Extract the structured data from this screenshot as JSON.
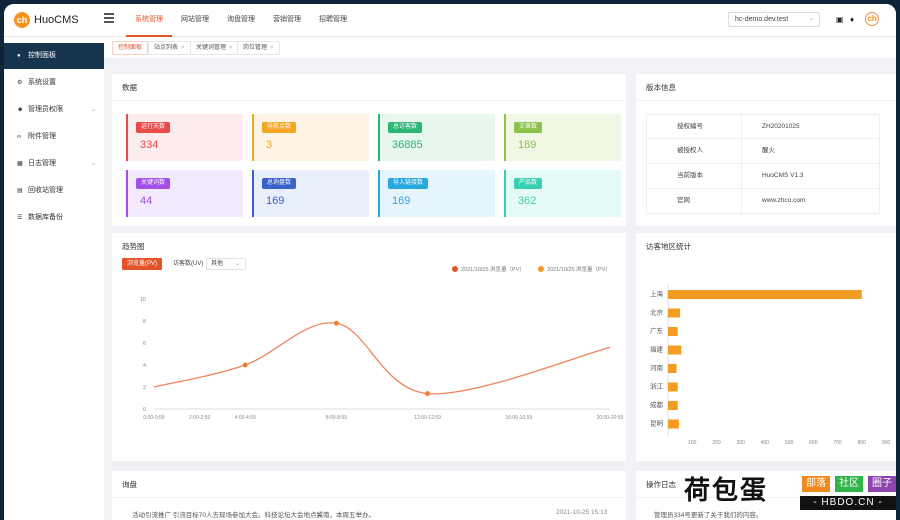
{
  "header": {
    "brand": "HuoCMS",
    "logo_text": "ch",
    "nav": [
      "系统管理",
      "网站管理",
      "询盘管理",
      "营销管理",
      "招聘管理"
    ],
    "site": "hc-demo.dev.test"
  },
  "sidebar": {
    "items": [
      {
        "label": "控制面板",
        "icon": "dashboard-icon"
      },
      {
        "label": "系统设置",
        "icon": "gear-icon"
      },
      {
        "label": "管理员权限",
        "icon": "user-icon"
      },
      {
        "label": "附件管理",
        "icon": "paperclip-icon"
      },
      {
        "label": "日志管理",
        "icon": "log-icon"
      },
      {
        "label": "回收站管理",
        "icon": "trash-icon"
      },
      {
        "label": "数据库备份",
        "icon": "database-icon"
      }
    ]
  },
  "tabs": [
    "控制面板",
    "站点列表",
    "关键词管理",
    "岗位管理"
  ],
  "data_card": {
    "title": "数据",
    "stats": [
      {
        "label": "运行天数",
        "value": "334",
        "color": "#e94b4b"
      },
      {
        "label": "导航点数",
        "value": "3",
        "color": "#f5a623"
      },
      {
        "label": "总访客数",
        "value": "36885",
        "color": "#2bb673"
      },
      {
        "label": "文章数",
        "value": "189",
        "color": "#8bc34a"
      },
      {
        "label": "关键词数",
        "value": "44",
        "color": "#a24ee8"
      },
      {
        "label": "总询盘数",
        "value": "169",
        "color": "#3a61c9"
      },
      {
        "label": "导入链接数",
        "value": "169",
        "color": "#29a8df"
      },
      {
        "label": "产品数",
        "value": "362",
        "color": "#38cfb5"
      }
    ]
  },
  "version_card": {
    "title": "版本信息",
    "rows": [
      {
        "key": "授权编号",
        "value": "ZH20201025"
      },
      {
        "key": "被授权人",
        "value": "醒火"
      },
      {
        "key": "当前版本",
        "value": "HuoCMS V1.3"
      },
      {
        "key": "官网",
        "value": "www.zhco.com"
      }
    ]
  },
  "trend_card": {
    "title": "趋势图",
    "toggles": [
      "浏览量(PV)",
      "访客数(UV)"
    ],
    "select": "其他",
    "legend": [
      "2021/10/25 浏览量（PV）",
      "2021/10/25 浏览量（PV）"
    ]
  },
  "region_card": {
    "title": "访客地区统计"
  },
  "inquiry_card": {
    "title": "询盘",
    "text": "活动引流推广  引流目标70人去现场参加大会。科技论坛大会地点冀南，本周五举办。",
    "time": "2021-10-25 15:13"
  },
  "oplog_card": {
    "title": "操作日志",
    "text": "管理员334号更新了关于我们的内容。"
  },
  "watermark": {
    "big": "荷包蛋",
    "tags": [
      "部落",
      "社区",
      "圈子"
    ],
    "url": "- HBDO.CN -"
  },
  "chart_data": [
    {
      "type": "line",
      "title": "",
      "x": [
        "0:00-0:59",
        "2:00-2:59",
        "4:00-4:59",
        "8:00-8:59",
        "12:00-12:59",
        "16:00-16:59",
        "20:00-20:59"
      ],
      "x_numeric": [
        0,
        2,
        4,
        8,
        12,
        16,
        20
      ],
      "series": [
        {
          "name": "2021/10/25 浏览量（PV）",
          "points": [
            [
              0,
              2
            ],
            [
              4,
              4
            ],
            [
              8,
              7.8
            ],
            [
              12,
              1.4
            ],
            [
              20,
              5.6
            ]
          ],
          "color": "#f0845a"
        }
      ],
      "ylim": [
        0,
        10
      ],
      "yticks": [
        0,
        2,
        4,
        6,
        8,
        10
      ],
      "grid": false,
      "legend": "top-right"
    },
    {
      "type": "bar",
      "orientation": "horizontal",
      "title": "",
      "categories": [
        "上海",
        "北京",
        "广东",
        "福建",
        "河南",
        "浙江",
        "成都",
        "昆明"
      ],
      "values": [
        800,
        50,
        40,
        55,
        35,
        40,
        40,
        45
      ],
      "xlim": [
        0,
        900
      ],
      "xticks": [
        100,
        200,
        300,
        400,
        500,
        600,
        700,
        800,
        900
      ],
      "color": "#f39c21",
      "grid": false
    }
  ]
}
